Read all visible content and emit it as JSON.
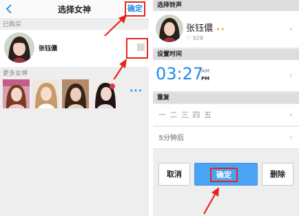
{
  "left": {
    "title": "选择女神",
    "confirm_label": "确定",
    "purchased_label": "已购买",
    "purchased": {
      "name": "张钰儂"
    },
    "more_label": "更多女神",
    "more_dots": "···"
  },
  "right": {
    "ringtone_label": "选择铃声",
    "ringtone": {
      "name": "张钰儂",
      "likes": "♡ 928"
    },
    "time_label": "设置时间",
    "time": {
      "hhmm": "03:27",
      "am": "AM",
      "pm": "PM"
    },
    "repeat_label": "重复",
    "repeat_value": "一 二 三 四 五",
    "snooze_value": "5分钟后",
    "buttons": {
      "cancel": "取消",
      "ok": "确定",
      "delete": "删除"
    }
  },
  "colors": {
    "accent": "#1e8ae8",
    "highlight": "#e4261c",
    "button": "#4aa3f5"
  }
}
